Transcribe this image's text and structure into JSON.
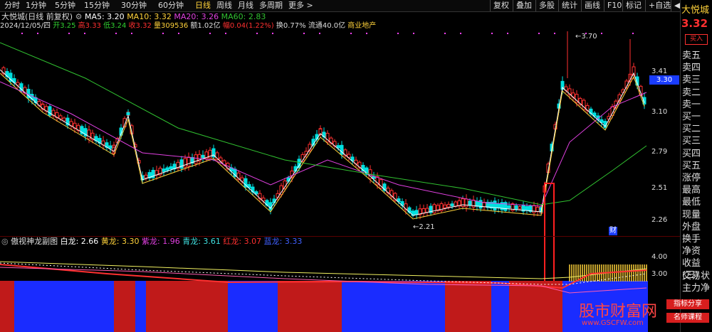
{
  "periods": [
    "分时",
    "1分钟",
    "5分钟",
    "15分钟",
    "30分钟",
    "60分钟",
    "日线",
    "周线",
    "月线",
    "多周期",
    "更多 >"
  ],
  "active_period": "日线",
  "tools": [
    "复权",
    "叠加",
    "多股",
    "统计",
    "画线",
    "F10",
    "标记",
    "+自选",
    "◀"
  ],
  "stock": {
    "name": "大悦城",
    "price": "3.32",
    "buy_label": "买入"
  },
  "quote_items": [
    "卖五",
    "卖四",
    "卖三",
    "卖二",
    "卖一",
    "买一",
    "买二",
    "买三",
    "买四",
    "买五",
    "涨停",
    "最高",
    "最低",
    "现量",
    "外盘",
    "换手",
    "净资",
    "收益(三)",
    "交易状",
    "主力净"
  ],
  "header": {
    "title": "大悦城(日线 前复权)",
    "ma5": "MA5: 3.20",
    "ma10": "MA10: 3.32",
    "ma20": "MA20: 3.26",
    "ma60": "MA60: 2.83",
    "date": "2024/12/05/四",
    "open": "开3.25",
    "high": "高3.33",
    "low": "低3.24",
    "close": "收3.32",
    "volume": "量309536",
    "amount": "额1.02亿",
    "change": "幅0.04(1.22%)",
    "turnover": "换0.77%",
    "float": "流通40.0亿",
    "sector": "商业地产"
  },
  "axis_labels": [
    "3.41",
    "3.10",
    "2.79",
    "2.51",
    "2.26"
  ],
  "current_price_box": "3.30",
  "annotations": {
    "high": "3.70",
    "low": "2.21",
    "cai": "财"
  },
  "sub_indicator": {
    "title": "傲视神龙副图",
    "white": "白龙: 2.66",
    "yellow": "黄龙: 3.30",
    "purple": "紫龙: 1.96",
    "cyan": "青龙: 3.61",
    "red": "红龙: 3.07",
    "blue": "蓝龙: 3.33"
  },
  "sub_axis": [
    "4.00",
    "3.00"
  ],
  "watermark": {
    "site": "股市财富网",
    "url": "www.GSCFW.com",
    "tag1": "指标分享",
    "tag2": "名师课程"
  },
  "colors": {
    "up": "#ff3030",
    "down": "#00e0e0",
    "ma5": "#ffffff",
    "ma10": "#ffd23a",
    "ma20": "#e040e0",
    "ma60": "#30c030"
  }
}
